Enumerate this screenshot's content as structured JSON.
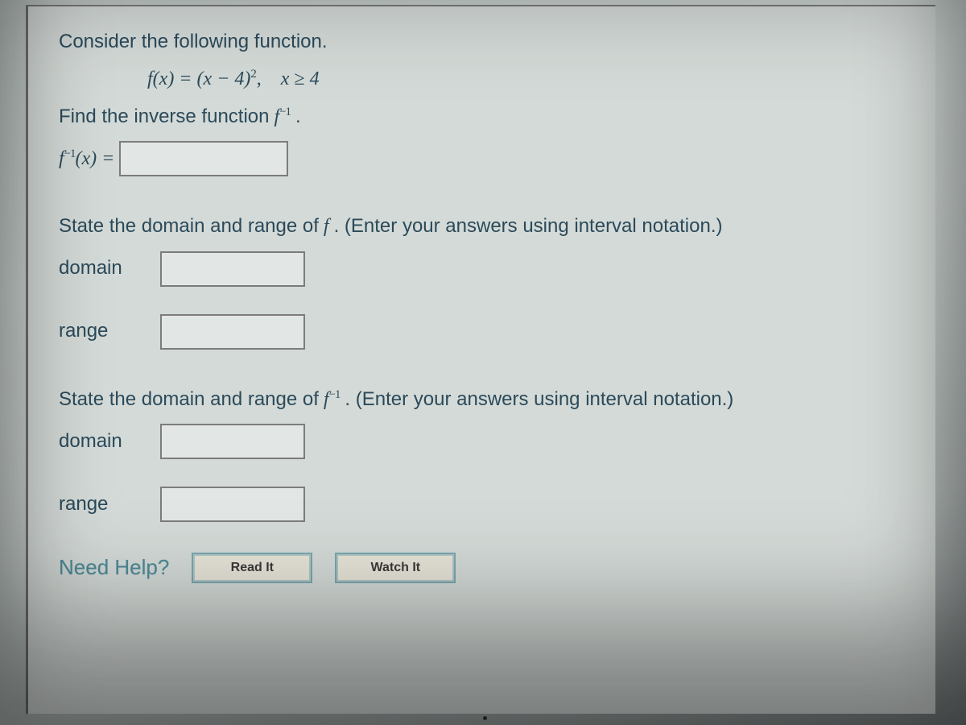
{
  "intro": "Consider the following function.",
  "func_def_prefix": "f(x) = (x − 4)",
  "func_def_exp": "2",
  "func_def_sep": ",",
  "domain_restriction": "x ≥ 4",
  "find_inverse_pre": "Find the inverse function ",
  "f_sym": "f",
  "inv_exp": "−1",
  "period": ".",
  "inv_label_prefix": "f",
  "inv_label_exp": "−1",
  "inv_label_suffix": "(x) =",
  "state_f_part1": "State the domain and range of ",
  "state_f_fn": "f",
  "state_f_part2": ". (Enter your answers using interval notation.)",
  "state_finv_part1": "State the domain and range of ",
  "state_finv_fn": "f",
  "state_finv_exp": "−1",
  "state_finv_part2": ". (Enter your answers using interval notation.)",
  "labels": {
    "domain": "domain",
    "range": "range"
  },
  "help": {
    "need": "Need Help?",
    "read": "Read It",
    "watch": "Watch It"
  }
}
